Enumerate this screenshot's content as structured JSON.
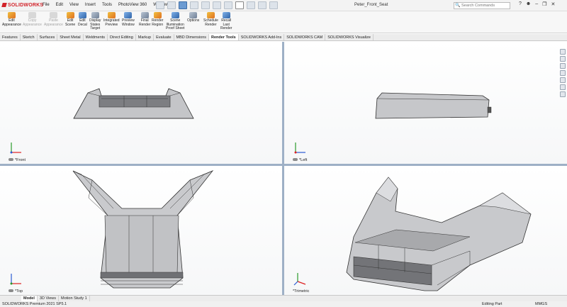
{
  "app": {
    "brand": "SOLIDWORKS",
    "document_title": "Peter_Front_Seat"
  },
  "menu": [
    "File",
    "Edit",
    "View",
    "Insert",
    "Tools",
    "PhotoView 360",
    "Window"
  ],
  "search": {
    "placeholder": "Search Commands"
  },
  "ribbon": [
    {
      "label": "Edit\nAppearance",
      "enabled": true,
      "icon": "appearance-icon"
    },
    {
      "label": "Copy\nAppearance",
      "enabled": false,
      "icon": "copy-appearance-icon"
    },
    {
      "label": "Paste\nAppearance",
      "enabled": false,
      "icon": "paste-appearance-icon"
    },
    {
      "label": "Edit\nScene",
      "enabled": true,
      "icon": "scene-icon"
    },
    {
      "label": "Edit\nDecal",
      "enabled": true,
      "icon": "decal-icon"
    },
    {
      "label": "Display\nStates\nTarget",
      "enabled": true,
      "icon": "display-states-icon"
    },
    {
      "label": "Integrated\nPreview",
      "enabled": true,
      "icon": "integrated-preview-icon"
    },
    {
      "label": "Preview\nWindow",
      "enabled": true,
      "icon": "preview-window-icon"
    },
    {
      "label": "Final\nRender",
      "enabled": true,
      "icon": "final-render-icon"
    },
    {
      "label": "Render\nRegion",
      "enabled": true,
      "icon": "render-region-icon"
    },
    {
      "label": "Scene\nIllumination\nProof Sheet",
      "enabled": true,
      "icon": "illumination-icon"
    },
    {
      "label": "Options",
      "enabled": true,
      "icon": "options-icon"
    },
    {
      "label": "Schedule\nRender",
      "enabled": true,
      "icon": "schedule-render-icon"
    },
    {
      "label": "Recall\nLast\nRender",
      "enabled": true,
      "icon": "recall-render-icon"
    }
  ],
  "command_tabs": [
    "Features",
    "Sketch",
    "Surfaces",
    "Sheet Metal",
    "Weldments",
    "Direct Editing",
    "Markup",
    "Evaluate",
    "MBD Dimensions",
    "Render Tools",
    "SOLIDWORKS Add-Ins",
    "SOLIDWORKS CAM",
    "SOLIDWORKS Visualize"
  ],
  "active_command_tab": "Render Tools",
  "viewports": {
    "front": "*Front",
    "left": "*Left",
    "top": "*Top",
    "trimetric": "*Trimetric"
  },
  "bottom_tabs": [
    "Model",
    "3D Views",
    "Motion Study 1"
  ],
  "active_bottom_tab": "Model",
  "status": {
    "product": "SOLIDWORKS Premium 2021 SP5.1",
    "mode": "Editing Part",
    "units": "MMGS"
  },
  "colors": {
    "accent": "#d2232a",
    "splitter": "#9eb0c6",
    "part": "#c8c9cc"
  }
}
